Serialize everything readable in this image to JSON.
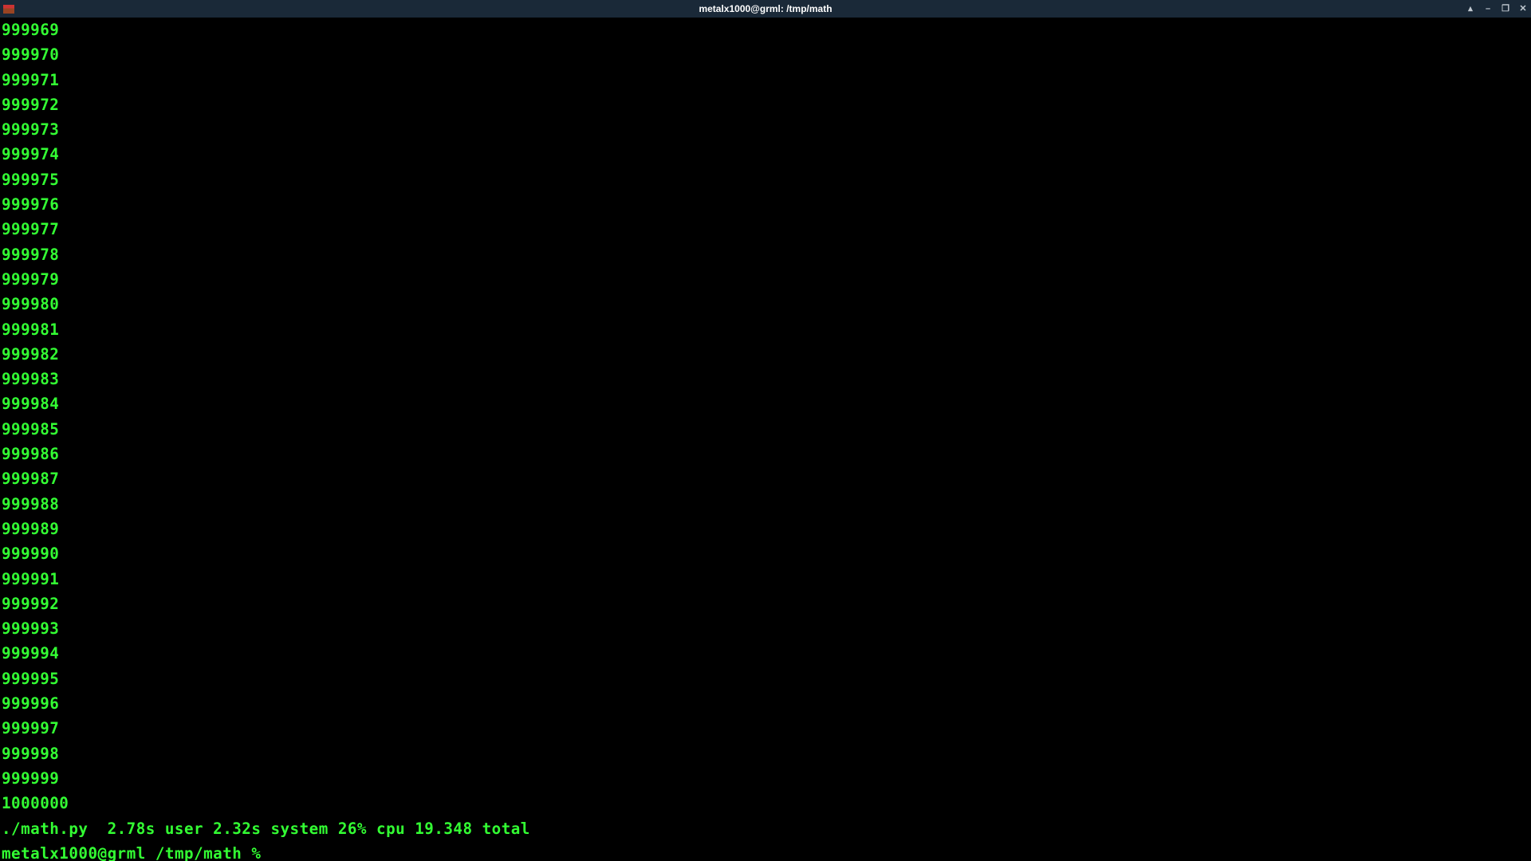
{
  "window": {
    "title": "metalx1000@grml: /tmp/math"
  },
  "output_lines": [
    "999969",
    "999970",
    "999971",
    "999972",
    "999973",
    "999974",
    "999975",
    "999976",
    "999977",
    "999978",
    "999979",
    "999980",
    "999981",
    "999982",
    "999983",
    "999984",
    "999985",
    "999986",
    "999987",
    "999988",
    "999989",
    "999990",
    "999991",
    "999992",
    "999993",
    "999994",
    "999995",
    "999996",
    "999997",
    "999998",
    "999999",
    "1000000"
  ],
  "timing_line": "./math.py  2.78s user 2.32s system 26% cpu 19.348 total",
  "prompt": {
    "user": "metalx1000",
    "at": "@",
    "host": "grml",
    "path": " /tmp/math ",
    "symbol": "%"
  }
}
